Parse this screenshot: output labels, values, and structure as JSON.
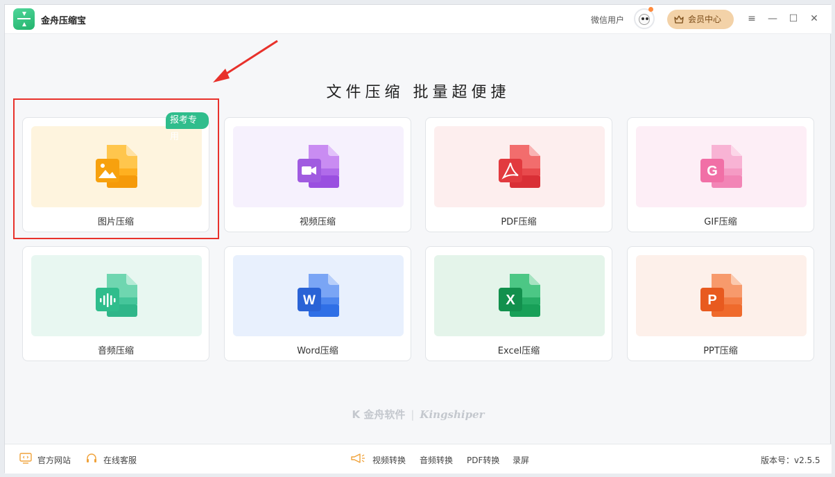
{
  "app": {
    "title": "金舟压缩宝"
  },
  "header": {
    "user_name": "微信用户",
    "vip_label": "会员中心",
    "menu_icon": "≡",
    "minimize_icon": "—",
    "maximize_icon": "☐",
    "close_icon": "✕"
  },
  "main": {
    "heading": "文件压缩  批量超便捷",
    "badge": "报考专用",
    "cards": [
      {
        "label": "图片压缩",
        "icon": "image-file-icon",
        "color": "#f5a623"
      },
      {
        "label": "视频压缩",
        "icon": "video-file-icon",
        "color": "#a05be0"
      },
      {
        "label": "PDF压缩",
        "icon": "pdf-file-icon",
        "color": "#e8383d"
      },
      {
        "label": "GIF压缩",
        "icon": "gif-file-icon",
        "color": "#f16fa6"
      },
      {
        "label": "音频压缩",
        "icon": "audio-file-icon",
        "color": "#2fbd8c"
      },
      {
        "label": "Word压缩",
        "icon": "word-file-icon",
        "color": "#2f6fe6"
      },
      {
        "label": "Excel压缩",
        "icon": "excel-file-icon",
        "color": "#18a058"
      },
      {
        "label": "PPT压缩",
        "icon": "ppt-file-icon",
        "color": "#f06227"
      }
    ],
    "watermark": {
      "cn": "金舟软件",
      "sep": "|",
      "en": "Kingshiper"
    }
  },
  "footer": {
    "website": "官方网站",
    "service": "在线客服",
    "links": [
      "视频转换",
      "音频转换",
      "PDF转换",
      "录屏"
    ],
    "version": "版本号：v2.5.5"
  }
}
